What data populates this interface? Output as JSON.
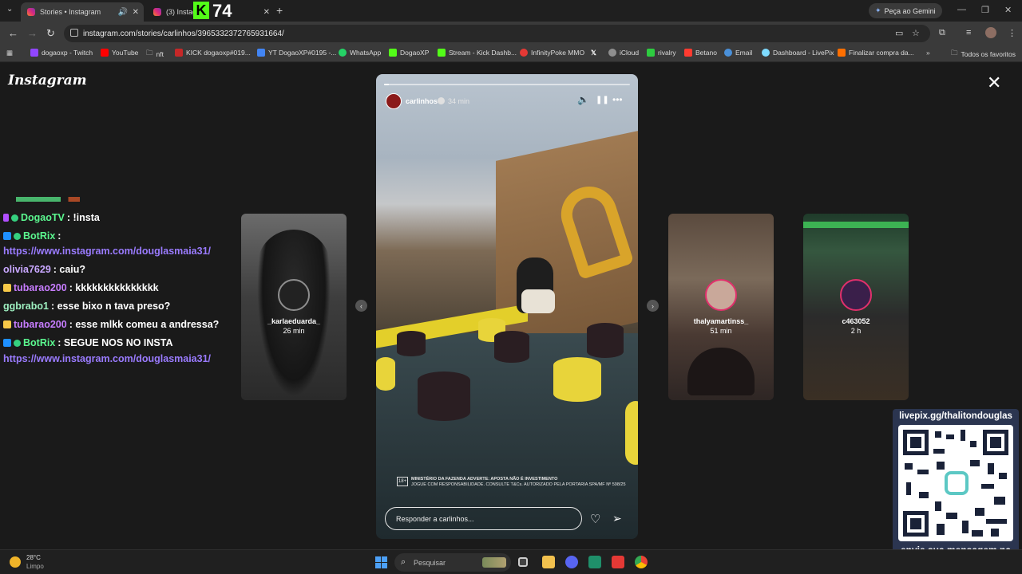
{
  "browser": {
    "tabs": [
      {
        "title": "Stories • Instagram",
        "active": true
      },
      {
        "title": "(3) Instag",
        "active": false
      }
    ],
    "kick_badge": "K",
    "kick_count": "74",
    "new_tab": "+",
    "gemini_label": "Peça ao Gemini",
    "url": "instagram.com/stories/carlinhos/3965332372765931664/",
    "bookmarks": [
      {
        "label": "dogaoxp - Twitch",
        "color": "#9146ff"
      },
      {
        "label": "YouTube",
        "color": "#ff0000"
      },
      {
        "label": "nft",
        "color": "#3a3a3a"
      },
      {
        "label": "KICK dogaoxp#019...",
        "color": "#53fc18"
      },
      {
        "label": "YT DogaoXP#0195 -...",
        "color": "#4285f4"
      },
      {
        "label": "WhatsApp",
        "color": "#25d366"
      },
      {
        "label": "DogaoXP",
        "color": "#53fc18"
      },
      {
        "label": "Stream - Kick Dashb...",
        "color": "#53fc18"
      },
      {
        "label": "InfinityPoke MMO",
        "color": "#e53935"
      },
      {
        "label": "",
        "color": "#000000"
      },
      {
        "label": "iCloud",
        "color": "#8e8e8e"
      },
      {
        "label": "rivalry",
        "color": "#2ecc40"
      },
      {
        "label": "Betano",
        "color": "#ff3b30"
      },
      {
        "label": "Email",
        "color": "#4a90d9"
      },
      {
        "label": "Dashboard - LivePix",
        "color": "#7fdbff"
      },
      {
        "label": "Finalizar compra da...",
        "color": "#ff6f00"
      }
    ],
    "all_bookmarks": "Todos os favoritos"
  },
  "instagram": {
    "logo": "Instagram",
    "close": "✕"
  },
  "chat": [
    {
      "user": "DogaoTV",
      "text": ": !insta",
      "color": "#5bf78f",
      "badge": "#b14fff"
    },
    {
      "user": "BotRix",
      "text": " :",
      "color": "#5bf78f",
      "badge": "#1e90ff"
    },
    {
      "link": "https://www.instagram.com/douglasmaia31/"
    },
    {
      "user": "olivia7629",
      "text": " : caiu?",
      "color": "#c9a8ff"
    },
    {
      "user": "tubarao200",
      "text": " : kkkkkkkkkkkkkkk",
      "color": "#c77dff",
      "badge": "#f7c948"
    },
    {
      "user": "ggbrabo1",
      "text": " : esse bixo n tava preso?",
      "color": "#9ef0c0"
    },
    {
      "user": "tubarao200",
      "text": " : esse mlkk comeu a andressa?",
      "color": "#c77dff",
      "badge": "#f7c948"
    },
    {
      "user": "BotRix",
      "text": " : SEGUE NOS NO INSTA",
      "color": "#5bf78f",
      "badge": "#1e90ff"
    },
    {
      "link": "https://www.instagram.com/douglasmaia31/"
    }
  ],
  "side_stories": [
    {
      "username": "_karlaeduarda_",
      "time": "26 min"
    },
    {
      "username": "thalyamartinss_",
      "time": "51 min"
    },
    {
      "username": "c463052",
      "time": "2 h"
    }
  ],
  "story": {
    "username": "carlinhos",
    "time": "34 min",
    "progress": 0.02,
    "age_rating": "18+",
    "disclaimer_line1": "MINISTÉRIO DA FAZENDA ADVERTE: APOSTA NÃO É INVESTIMENTO",
    "disclaimer_line2": "JOGUE COM RESPONSABILIDADE. CONSULTE T&Cs. AUTORIZADO PELA PORTARIA SPA/MF Nº 598/25",
    "reply_placeholder": "Responder a carlinhos...",
    "mute_icon": "🔈",
    "pause_icon": "❚❚",
    "more_icon": "•••",
    "like_icon": "♡",
    "share_icon": "➢"
  },
  "livepix": {
    "url": "livepix.gg/thalitondouglas",
    "message": "envie sua mensagem na live via pix!"
  },
  "taskbar": {
    "temperature": "28°C",
    "condition": "Limpo",
    "search_placeholder": "Pesquisar"
  }
}
